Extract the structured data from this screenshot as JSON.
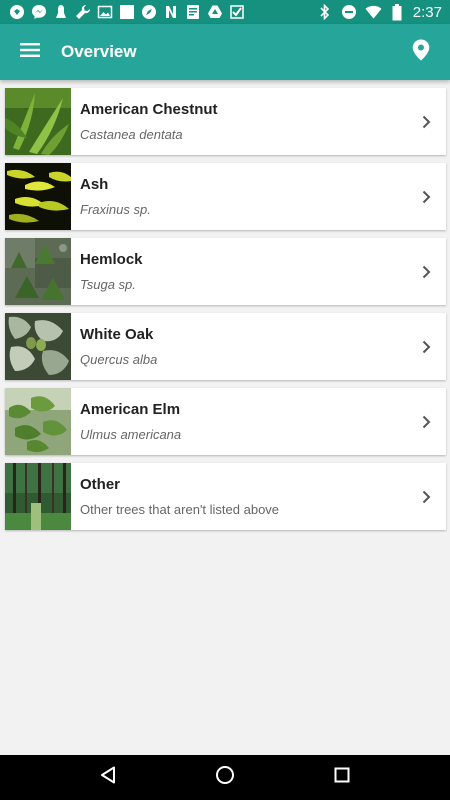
{
  "status_bar": {
    "time": "2:37",
    "icons": [
      "notification-app-icon",
      "messenger-icon",
      "notification-bell-icon",
      "wrench-icon",
      "image-icon",
      "square-icon",
      "compass-icon",
      "n-app-icon",
      "document-icon",
      "drive-icon",
      "check-icon",
      "bluetooth-icon",
      "do-not-disturb-icon",
      "wifi-icon",
      "battery-icon"
    ]
  },
  "app_bar": {
    "title": "Overview",
    "menu_icon": "menu-icon",
    "location_icon": "location-pin-icon"
  },
  "trees": [
    {
      "name": "American Chestnut",
      "subtitle": "Castanea dentata",
      "italic": true,
      "thumb": "american-chestnut-photo"
    },
    {
      "name": "Ash",
      "subtitle": "Fraxinus sp.",
      "italic": true,
      "thumb": "ash-photo"
    },
    {
      "name": "Hemlock",
      "subtitle": "Tsuga sp.",
      "italic": true,
      "thumb": "hemlock-photo"
    },
    {
      "name": "White Oak",
      "subtitle": "Quercus alba",
      "italic": true,
      "thumb": "white-oak-photo"
    },
    {
      "name": "American Elm",
      "subtitle": "Ulmus americana",
      "italic": true,
      "thumb": "american-elm-photo"
    },
    {
      "name": "Other",
      "subtitle": "Other trees that aren't listed above",
      "italic": false,
      "thumb": "forest-photo"
    }
  ],
  "nav_bar": {
    "buttons": [
      "back-icon",
      "home-icon",
      "recents-icon"
    ]
  },
  "colors": {
    "status_bar": "#16917f",
    "app_bar": "#26a69a",
    "background": "#f2f2f2"
  }
}
